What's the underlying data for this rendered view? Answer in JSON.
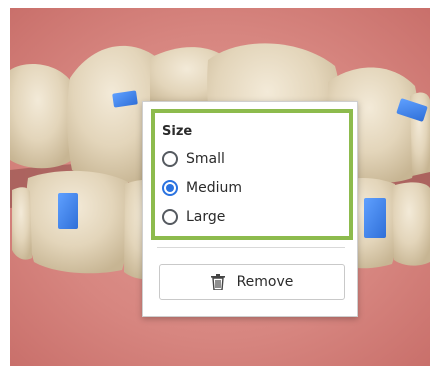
{
  "popup": {
    "group_title": "Size",
    "options": [
      {
        "label": "Small",
        "checked": false
      },
      {
        "label": "Medium",
        "checked": true
      },
      {
        "label": "Large",
        "checked": false
      }
    ],
    "remove_label": "Remove",
    "remove_icon": "trash-icon"
  },
  "colors": {
    "accent": "#2b73e0",
    "group_highlight": "#8dbb4d",
    "attachment_blue": "#3b82f0",
    "gum": "#d98a86",
    "tooth": "#e2d5bd"
  }
}
